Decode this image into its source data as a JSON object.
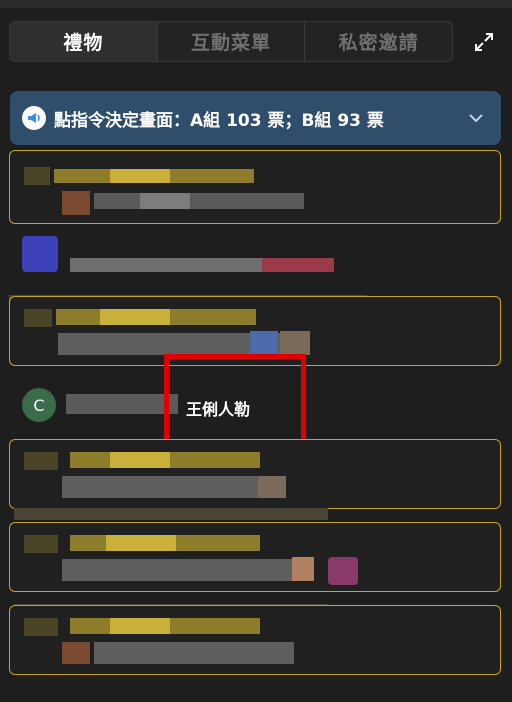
{
  "tabs": [
    {
      "label": "禮物",
      "active": true
    },
    {
      "label": "互動菜單",
      "active": false
    },
    {
      "label": "私密邀請",
      "active": false
    }
  ],
  "announcement": {
    "text": "點指令決定畫面：A組 103 票；B組 93 票"
  },
  "messages": [
    {
      "avatar_letter": "C",
      "avatar_color": "#3a6b4a",
      "text": "王俐人勒"
    }
  ],
  "colors": {
    "background": "#1e1e1e",
    "banner": "#2f4e6c",
    "card_border": "#c9a527",
    "highlight": "#e00000"
  }
}
